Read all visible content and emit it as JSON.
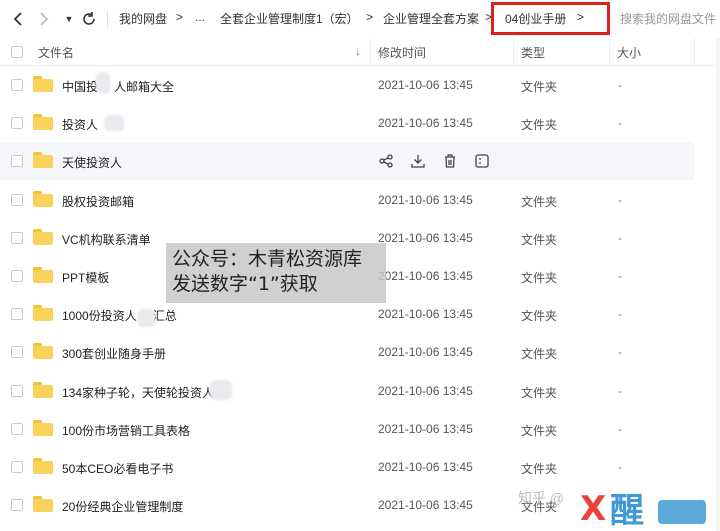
{
  "breadcrumbs": [
    "我的网盘",
    "...",
    "全套企业管理制度1（宏）",
    "企业管理全套方案",
    "04创业手册"
  ],
  "search": {
    "placeholder": "搜索我的网盘文件"
  },
  "columns": {
    "name": "文件名",
    "modified": "修改时间",
    "type": "类型",
    "size": "大小"
  },
  "files": [
    {
      "name": "中国投",
      "name2": "人邮箱大全",
      "date": "2021-10-06 13:45",
      "type": "文件夹",
      "size": "-"
    },
    {
      "name": "投资人",
      "name2": "",
      "date": "2021-10-06 13:45",
      "type": "文件夹",
      "size": "-"
    },
    {
      "name": "天使投资人",
      "name2": "",
      "date": "",
      "type": "",
      "size": ""
    },
    {
      "name": "股权投资邮箱",
      "name2": "",
      "date": "2021-10-06 13:45",
      "type": "文件夹",
      "size": "-"
    },
    {
      "name": "VC机构联系清单",
      "name2": "",
      "date": "2021-10-06 13:45",
      "type": "文件夹",
      "size": "-"
    },
    {
      "name": "PPT模板",
      "name2": "",
      "date": "2021-10-06 13:45",
      "type": "文件夹",
      "size": "-"
    },
    {
      "name": "1000份投资人",
      "name2": "汇总",
      "date": "2021-10-06 13:45",
      "type": "文件夹",
      "size": "-"
    },
    {
      "name": "300套创业随身手册",
      "name2": "",
      "date": "2021-10-06 13:45",
      "type": "文件夹",
      "size": "-"
    },
    {
      "name": "134家种子轮，天使轮投资人",
      "name2": "",
      "date": "2021-10-06 13:45",
      "type": "文件夹",
      "size": "-"
    },
    {
      "name": "100份市场营销工具表格",
      "name2": "",
      "date": "2021-10-06 13:45",
      "type": "文件夹",
      "size": "-"
    },
    {
      "name": "50本CEO必看电子书",
      "name2": "",
      "date": "2021-10-06 13:45",
      "type": "文件夹",
      "size": "-"
    },
    {
      "name": "20份经典企业管理制度",
      "name2": "",
      "date": "2021-10-06 13:45",
      "type": "文件夹",
      "size": "-"
    }
  ],
  "overlay": {
    "line1": "公众号：木青松资源库",
    "line2": "发送数字“1”获取"
  },
  "watermark": {
    "zhihu": "知乎 @",
    "logo_text": "X",
    "logo_chars": "醒"
  },
  "colors": {
    "highlight_border": "#e0201c",
    "folder": "#f8d25a",
    "sort_arrow": "#3a8ee6"
  }
}
